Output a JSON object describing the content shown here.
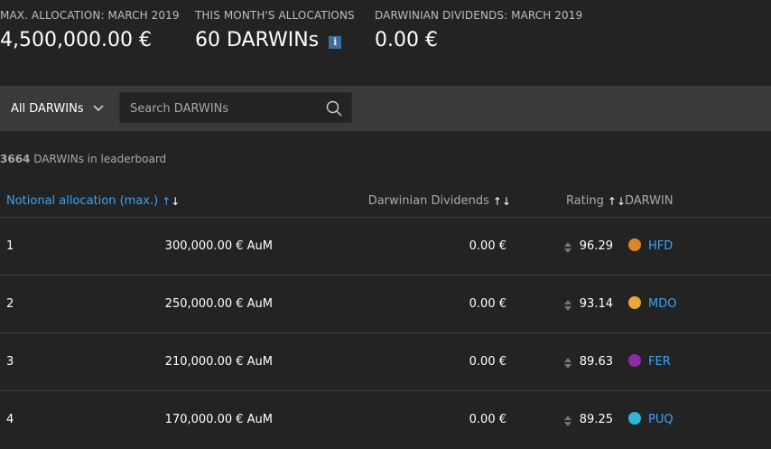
{
  "stats": [
    {
      "label": "MAX. ALLOCATION: MARCH 2019",
      "value": "4,500,000.00 €"
    },
    {
      "label": "THIS MONTH'S ALLOCATIONS",
      "value": "60 DARWINs"
    },
    {
      "label": "DARWINIAN DIVIDENDS: MARCH 2019",
      "value": "0.00 €"
    }
  ],
  "info_icon": "i",
  "toolbar": {
    "filter_label": "All DARWINs",
    "search_placeholder": "Search DARWINs"
  },
  "leaderboard": {
    "count": "3664",
    "count_suffix": " DARWINs in leaderboard"
  },
  "columns": {
    "allocation": "Notional allocation (max.)",
    "dividends": "Darwinian Dividends",
    "rating": "Rating",
    "darwin": "DARWIN"
  },
  "rows": [
    {
      "rank": "1",
      "aum": "300,000.00 € AuM",
      "dividends": "0.00 €",
      "rating": "96.29",
      "darwin": "HFD",
      "color": "#d9892a"
    },
    {
      "rank": "2",
      "aum": "250,000.00 € AuM",
      "dividends": "0.00 €",
      "rating": "93.14",
      "darwin": "MDO",
      "color": "#eaa83a"
    },
    {
      "rank": "3",
      "aum": "210,000.00 € AuM",
      "dividends": "0.00 €",
      "rating": "89.63",
      "darwin": "FER",
      "color": "#8e2ca8"
    },
    {
      "rank": "4",
      "aum": "170,000.00 € AuM",
      "dividends": "0.00 €",
      "rating": "89.25",
      "darwin": "PUQ",
      "color": "#2eb6d9"
    }
  ]
}
